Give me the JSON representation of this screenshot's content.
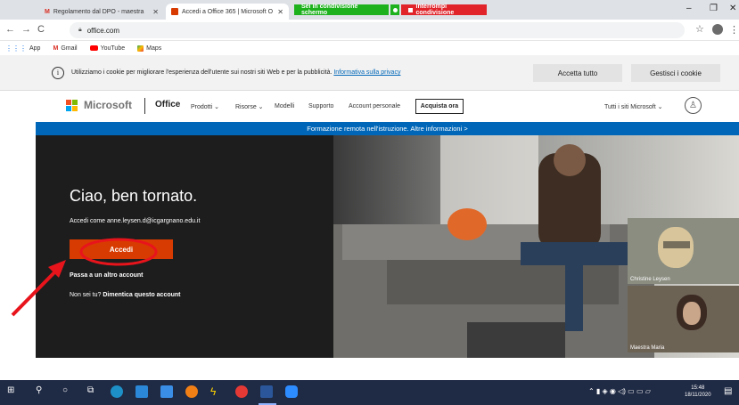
{
  "browser": {
    "tabs": [
      {
        "label": "Regolamento dal DPO - maestra",
        "active": false
      },
      {
        "label": "Accedi a Office 365 | Microsoft O",
        "active": true
      }
    ],
    "sharing": {
      "status_label": "Sei in condivisione schermo",
      "stop_label": "Interrompi condivisione"
    },
    "url": "office.com",
    "bookmarks": [
      "App",
      "Gmail",
      "YouTube",
      "Maps"
    ]
  },
  "cookie_banner": {
    "text": "Utilizziamo i cookie per migliorare l'esperienza dell'utente sui nostri siti Web e per la pubblicità.",
    "link": "Informativa sulla privacy",
    "accept_label": "Accetta tutto",
    "manage_label": "Gestisci i cookie"
  },
  "header": {
    "brand": "Microsoft",
    "product": "Office",
    "nav": [
      "Prodotti",
      "Risorse",
      "Modelli",
      "Supporto",
      "Account personale"
    ],
    "buy_label": "Acquista ora",
    "all_sites": "Tutti i siti Microsoft"
  },
  "banner": {
    "text": "Formazione remota nell'istruzione. Altre informazioni >"
  },
  "hero": {
    "title": "Ciao, ben tornato.",
    "signed_as": "Accedi come anne.leysen.d@icgargnano.edu.it",
    "signin_label": "Accedi",
    "other_account": "Passa a un altro account",
    "forget_prefix": "Non sei tu?",
    "forget_link": "Dimentica questo account"
  },
  "video_call": {
    "participants": [
      "Christine Leysen",
      "Maestra Maria"
    ]
  },
  "taskbar": {
    "time": "15:48",
    "date": "18/11/2020"
  },
  "colors": {
    "accent_blue": "#0067b8",
    "signin_orange": "#d83b01",
    "annotation_red": "#e8141c",
    "sharing_green": "#1db21d",
    "sharing_red": "#e0242a"
  }
}
